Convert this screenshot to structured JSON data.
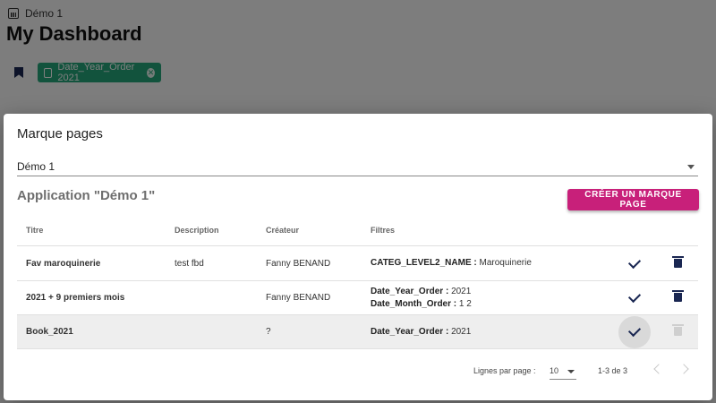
{
  "background": {
    "breadcrumb": "Démo 1",
    "page_title": "My Dashboard",
    "filter_chip": "Date_Year_Order 2021"
  },
  "modal": {
    "title": "Marque pages",
    "app_select_value": "Démo 1",
    "app_heading": "Application \"Démo 1\"",
    "create_button": "CRÉER UN MARQUE PAGE",
    "columns": {
      "titre": "Titre",
      "description": "Description",
      "createur": "Créateur",
      "filtres": "Filtres"
    },
    "rows": [
      {
        "titre": "Fav maroquinerie",
        "description": "test fbd",
        "createur": "Fanny BENAND",
        "filters": [
          {
            "key": "CATEG_LEVEL2_NAME :",
            "value": "Maroquinerie"
          }
        ]
      },
      {
        "titre": "2021 + 9 premiers mois",
        "description": "",
        "createur": "Fanny BENAND",
        "filters": [
          {
            "key": "Date_Year_Order :",
            "value": "2021"
          },
          {
            "key": "Date_Month_Order :",
            "value": "1 2"
          }
        ]
      },
      {
        "titre": "Book_2021",
        "description": "",
        "createur": "?",
        "filters": [
          {
            "key": "Date_Year_Order :",
            "value": "2021"
          }
        ]
      }
    ],
    "pagination": {
      "rows_per_page_label": "Lignes par page :",
      "rows_per_page_value": "10",
      "range": "1-3 de 3"
    }
  },
  "colors": {
    "accent": "#c8207a",
    "chip": "#25a77b",
    "icon_navy": "#1a2752"
  }
}
